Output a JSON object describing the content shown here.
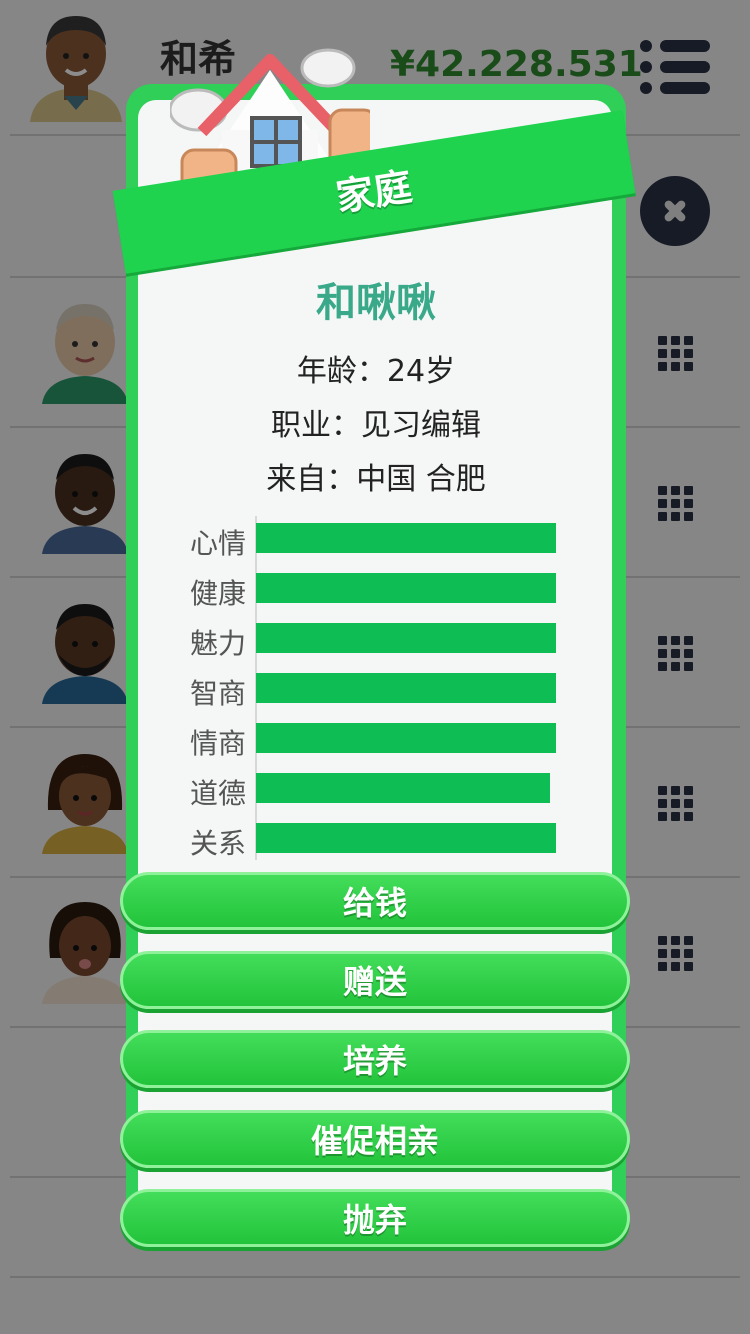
{
  "header": {
    "player_name": "和希",
    "money": "¥42.228.531"
  },
  "modal": {
    "title": "家庭",
    "person_name": "和啾啾",
    "age_text": "年龄：24岁",
    "job_text": "职业：见习编辑",
    "from_text": "来自：中国 合肥",
    "stats": [
      {
        "label": "心情",
        "value": 1.0
      },
      {
        "label": "健康",
        "value": 1.0
      },
      {
        "label": "魅力",
        "value": 1.0
      },
      {
        "label": "智商",
        "value": 1.0
      },
      {
        "label": "情商",
        "value": 1.0
      },
      {
        "label": "道德",
        "value": 0.98
      },
      {
        "label": "关系",
        "value": 1.0
      }
    ],
    "actions": [
      "给钱",
      "赠送",
      "培养",
      "催促相亲",
      "抛弃"
    ]
  },
  "colors": {
    "modal_green": "#2fcf58",
    "stat_bar": "#0fbd55",
    "name_teal": "#3aa98a",
    "money_green": "#2e8b2e"
  }
}
